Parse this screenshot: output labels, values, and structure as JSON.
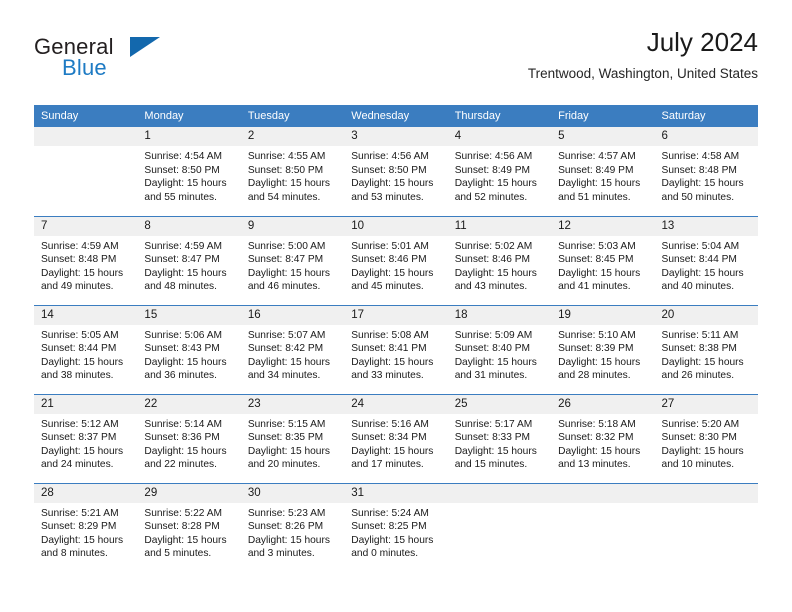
{
  "brand": {
    "word_one": "General",
    "word_two": "Blue",
    "triangle_icon": "triangle-icon",
    "accent_color": "#1368ad",
    "text_color": "#231f20"
  },
  "header": {
    "title": "July 2024",
    "subtitle": "Trentwood, Washington, United States"
  },
  "calendar": {
    "header_bg": "#3b7dc0",
    "daynum_bg": "#f0f0f0",
    "weekdays": [
      "Sunday",
      "Monday",
      "Tuesday",
      "Wednesday",
      "Thursday",
      "Friday",
      "Saturday"
    ],
    "weeks": [
      [
        {
          "day": "",
          "sunrise": "",
          "sunset": "",
          "daylight": "",
          "daylight2": ""
        },
        {
          "day": "1",
          "sunrise": "Sunrise: 4:54 AM",
          "sunset": "Sunset: 8:50 PM",
          "daylight": "Daylight: 15 hours",
          "daylight2": "and 55 minutes."
        },
        {
          "day": "2",
          "sunrise": "Sunrise: 4:55 AM",
          "sunset": "Sunset: 8:50 PM",
          "daylight": "Daylight: 15 hours",
          "daylight2": "and 54 minutes."
        },
        {
          "day": "3",
          "sunrise": "Sunrise: 4:56 AM",
          "sunset": "Sunset: 8:50 PM",
          "daylight": "Daylight: 15 hours",
          "daylight2": "and 53 minutes."
        },
        {
          "day": "4",
          "sunrise": "Sunrise: 4:56 AM",
          "sunset": "Sunset: 8:49 PM",
          "daylight": "Daylight: 15 hours",
          "daylight2": "and 52 minutes."
        },
        {
          "day": "5",
          "sunrise": "Sunrise: 4:57 AM",
          "sunset": "Sunset: 8:49 PM",
          "daylight": "Daylight: 15 hours",
          "daylight2": "and 51 minutes."
        },
        {
          "day": "6",
          "sunrise": "Sunrise: 4:58 AM",
          "sunset": "Sunset: 8:48 PM",
          "daylight": "Daylight: 15 hours",
          "daylight2": "and 50 minutes."
        }
      ],
      [
        {
          "day": "7",
          "sunrise": "Sunrise: 4:59 AM",
          "sunset": "Sunset: 8:48 PM",
          "daylight": "Daylight: 15 hours",
          "daylight2": "and 49 minutes."
        },
        {
          "day": "8",
          "sunrise": "Sunrise: 4:59 AM",
          "sunset": "Sunset: 8:47 PM",
          "daylight": "Daylight: 15 hours",
          "daylight2": "and 48 minutes."
        },
        {
          "day": "9",
          "sunrise": "Sunrise: 5:00 AM",
          "sunset": "Sunset: 8:47 PM",
          "daylight": "Daylight: 15 hours",
          "daylight2": "and 46 minutes."
        },
        {
          "day": "10",
          "sunrise": "Sunrise: 5:01 AM",
          "sunset": "Sunset: 8:46 PM",
          "daylight": "Daylight: 15 hours",
          "daylight2": "and 45 minutes."
        },
        {
          "day": "11",
          "sunrise": "Sunrise: 5:02 AM",
          "sunset": "Sunset: 8:46 PM",
          "daylight": "Daylight: 15 hours",
          "daylight2": "and 43 minutes."
        },
        {
          "day": "12",
          "sunrise": "Sunrise: 5:03 AM",
          "sunset": "Sunset: 8:45 PM",
          "daylight": "Daylight: 15 hours",
          "daylight2": "and 41 minutes."
        },
        {
          "day": "13",
          "sunrise": "Sunrise: 5:04 AM",
          "sunset": "Sunset: 8:44 PM",
          "daylight": "Daylight: 15 hours",
          "daylight2": "and 40 minutes."
        }
      ],
      [
        {
          "day": "14",
          "sunrise": "Sunrise: 5:05 AM",
          "sunset": "Sunset: 8:44 PM",
          "daylight": "Daylight: 15 hours",
          "daylight2": "and 38 minutes."
        },
        {
          "day": "15",
          "sunrise": "Sunrise: 5:06 AM",
          "sunset": "Sunset: 8:43 PM",
          "daylight": "Daylight: 15 hours",
          "daylight2": "and 36 minutes."
        },
        {
          "day": "16",
          "sunrise": "Sunrise: 5:07 AM",
          "sunset": "Sunset: 8:42 PM",
          "daylight": "Daylight: 15 hours",
          "daylight2": "and 34 minutes."
        },
        {
          "day": "17",
          "sunrise": "Sunrise: 5:08 AM",
          "sunset": "Sunset: 8:41 PM",
          "daylight": "Daylight: 15 hours",
          "daylight2": "and 33 minutes."
        },
        {
          "day": "18",
          "sunrise": "Sunrise: 5:09 AM",
          "sunset": "Sunset: 8:40 PM",
          "daylight": "Daylight: 15 hours",
          "daylight2": "and 31 minutes."
        },
        {
          "day": "19",
          "sunrise": "Sunrise: 5:10 AM",
          "sunset": "Sunset: 8:39 PM",
          "daylight": "Daylight: 15 hours",
          "daylight2": "and 28 minutes."
        },
        {
          "day": "20",
          "sunrise": "Sunrise: 5:11 AM",
          "sunset": "Sunset: 8:38 PM",
          "daylight": "Daylight: 15 hours",
          "daylight2": "and 26 minutes."
        }
      ],
      [
        {
          "day": "21",
          "sunrise": "Sunrise: 5:12 AM",
          "sunset": "Sunset: 8:37 PM",
          "daylight": "Daylight: 15 hours",
          "daylight2": "and 24 minutes."
        },
        {
          "day": "22",
          "sunrise": "Sunrise: 5:14 AM",
          "sunset": "Sunset: 8:36 PM",
          "daylight": "Daylight: 15 hours",
          "daylight2": "and 22 minutes."
        },
        {
          "day": "23",
          "sunrise": "Sunrise: 5:15 AM",
          "sunset": "Sunset: 8:35 PM",
          "daylight": "Daylight: 15 hours",
          "daylight2": "and 20 minutes."
        },
        {
          "day": "24",
          "sunrise": "Sunrise: 5:16 AM",
          "sunset": "Sunset: 8:34 PM",
          "daylight": "Daylight: 15 hours",
          "daylight2": "and 17 minutes."
        },
        {
          "day": "25",
          "sunrise": "Sunrise: 5:17 AM",
          "sunset": "Sunset: 8:33 PM",
          "daylight": "Daylight: 15 hours",
          "daylight2": "and 15 minutes."
        },
        {
          "day": "26",
          "sunrise": "Sunrise: 5:18 AM",
          "sunset": "Sunset: 8:32 PM",
          "daylight": "Daylight: 15 hours",
          "daylight2": "and 13 minutes."
        },
        {
          "day": "27",
          "sunrise": "Sunrise: 5:20 AM",
          "sunset": "Sunset: 8:30 PM",
          "daylight": "Daylight: 15 hours",
          "daylight2": "and 10 minutes."
        }
      ],
      [
        {
          "day": "28",
          "sunrise": "Sunrise: 5:21 AM",
          "sunset": "Sunset: 8:29 PM",
          "daylight": "Daylight: 15 hours",
          "daylight2": "and 8 minutes."
        },
        {
          "day": "29",
          "sunrise": "Sunrise: 5:22 AM",
          "sunset": "Sunset: 8:28 PM",
          "daylight": "Daylight: 15 hours",
          "daylight2": "and 5 minutes."
        },
        {
          "day": "30",
          "sunrise": "Sunrise: 5:23 AM",
          "sunset": "Sunset: 8:26 PM",
          "daylight": "Daylight: 15 hours",
          "daylight2": "and 3 minutes."
        },
        {
          "day": "31",
          "sunrise": "Sunrise: 5:24 AM",
          "sunset": "Sunset: 8:25 PM",
          "daylight": "Daylight: 15 hours",
          "daylight2": "and 0 minutes."
        },
        {
          "day": "",
          "sunrise": "",
          "sunset": "",
          "daylight": "",
          "daylight2": ""
        },
        {
          "day": "",
          "sunrise": "",
          "sunset": "",
          "daylight": "",
          "daylight2": ""
        },
        {
          "day": "",
          "sunrise": "",
          "sunset": "",
          "daylight": "",
          "daylight2": ""
        }
      ]
    ]
  }
}
